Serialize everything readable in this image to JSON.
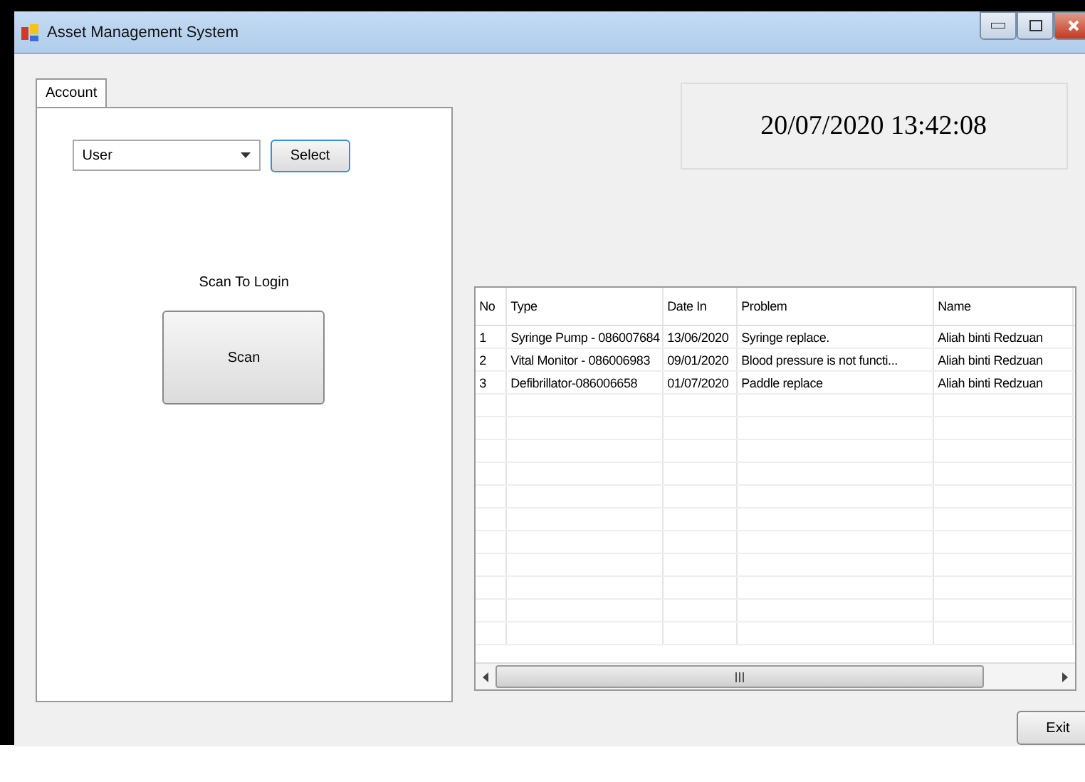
{
  "window": {
    "title": "Asset Management System"
  },
  "tabs": [
    {
      "label": "Account",
      "selected": true
    }
  ],
  "account": {
    "user_combo": {
      "value": "User"
    },
    "select_button": "Select",
    "scan_prompt": "Scan To Login",
    "scan_button": "Scan"
  },
  "clock": "20/07/2020 13:42:08",
  "table": {
    "columns": [
      "No",
      "Type",
      "Date In",
      "Problem",
      "Name"
    ],
    "rows": [
      {
        "cells": [
          "1",
          "Syringe Pump - 086007684",
          "13/06/2020",
          "Syringe replace.",
          "Aliah binti Redzuan"
        ]
      },
      {
        "cells": [
          "2",
          "Vital Monitor - 086006983",
          "09/01/2020",
          "Blood pressure is not functi...",
          "Aliah binti Redzuan"
        ]
      },
      {
        "cells": [
          "3",
          "Defibrillator-086006658",
          "01/07/2020",
          "Paddle replace",
          "Aliah binti Redzuan"
        ]
      }
    ]
  },
  "exit_button": "Exit"
}
